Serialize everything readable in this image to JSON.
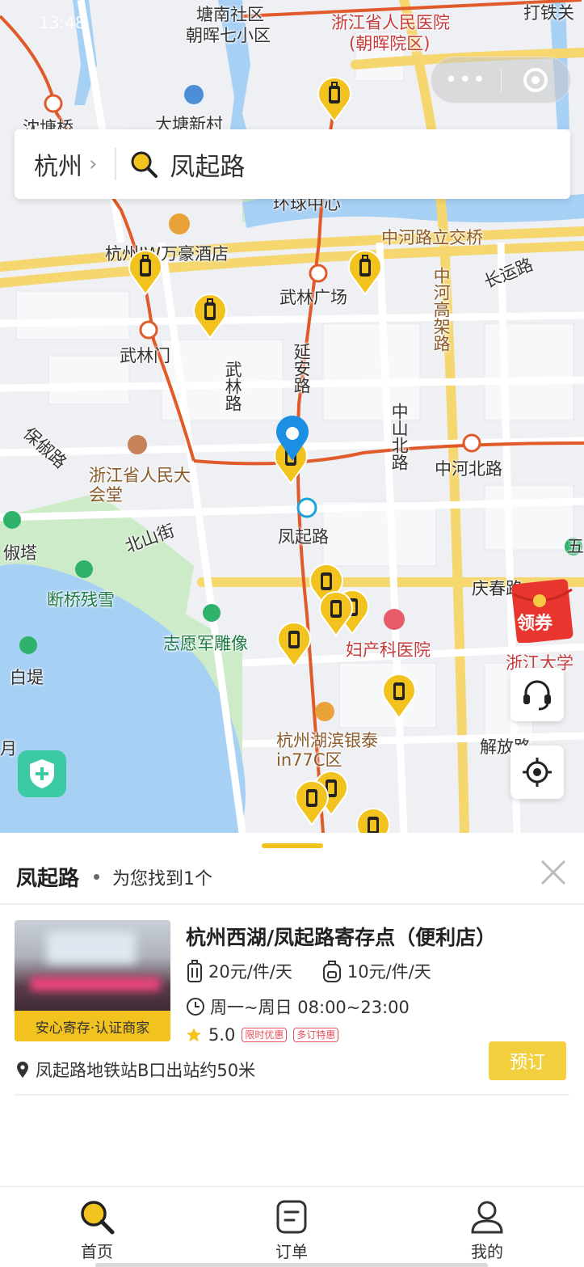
{
  "status": {
    "time": "13:48"
  },
  "mini_program": {
    "more_label": "•••"
  },
  "search": {
    "city": "杭州",
    "chevron": "›",
    "query": "凤起路"
  },
  "map": {
    "labels": {
      "tangnan": "塘南社区",
      "zhaohui": "朝晖七小区",
      "hospital1": "浙江省人民医院",
      "hospital1b": "(朝晖院区)",
      "datiexin": "大塘新村",
      "shentang": "沈塘桥",
      "datieguan": "打铁关",
      "huanqiu": "环球中心",
      "zhonghe_bridge": "中河路立交桥",
      "jw_hotel": "杭州JW万豪酒店",
      "wulin_square": "武林广场",
      "changyun": "长运路",
      "wulinmen": "武林门",
      "zhonghe_elevated": "中河高架路",
      "yanan": "延安路",
      "wulin_road": "武林路",
      "baochu": "保俶路",
      "zhongshan_north": "中山北路",
      "zhonghe_north": "中河北路",
      "dahuitang": "浙江省人民大会堂",
      "fengqi_station": "凤起路",
      "beishan": "北山街",
      "baoshu_ta": "俶塔",
      "duanqiao": "断桥残雪",
      "qingchun": "庆春路",
      "volunteer": "志愿军雕像",
      "fuchan": "妇产科医院",
      "zju": "浙江大学",
      "baidi": "白堤",
      "jiefang": "解放路",
      "hubin": "杭州湖滨银泰in77C区",
      "yue": "月",
      "wu": "五"
    }
  },
  "coupon": {
    "label": "领券"
  },
  "panel": {
    "query": "凤起路",
    "found_text": "为您找到1个",
    "shop": {
      "badge": "安心寄存·认证商家",
      "title": "杭州西湖/凤起路寄存点（便利店）",
      "price_luggage": "20元/件/天",
      "price_bag": "10元/件/天",
      "hours": "周一~周日 08:00~23:00",
      "rating": "5.0",
      "tag1": "限时优惠",
      "tag2": "多订特惠",
      "book_label": "预订",
      "address": "凤起路地铁站B口出站约50米"
    }
  },
  "tabs": [
    {
      "label": "首页",
      "icon": "search-icon"
    },
    {
      "label": "订单",
      "icon": "order-icon"
    },
    {
      "label": "我的",
      "icon": "user-icon"
    }
  ],
  "colors": {
    "accent": "#F2C31E",
    "metro": "#E05A2A",
    "water": "#A7D0F5",
    "park": "#CDEBC8"
  }
}
